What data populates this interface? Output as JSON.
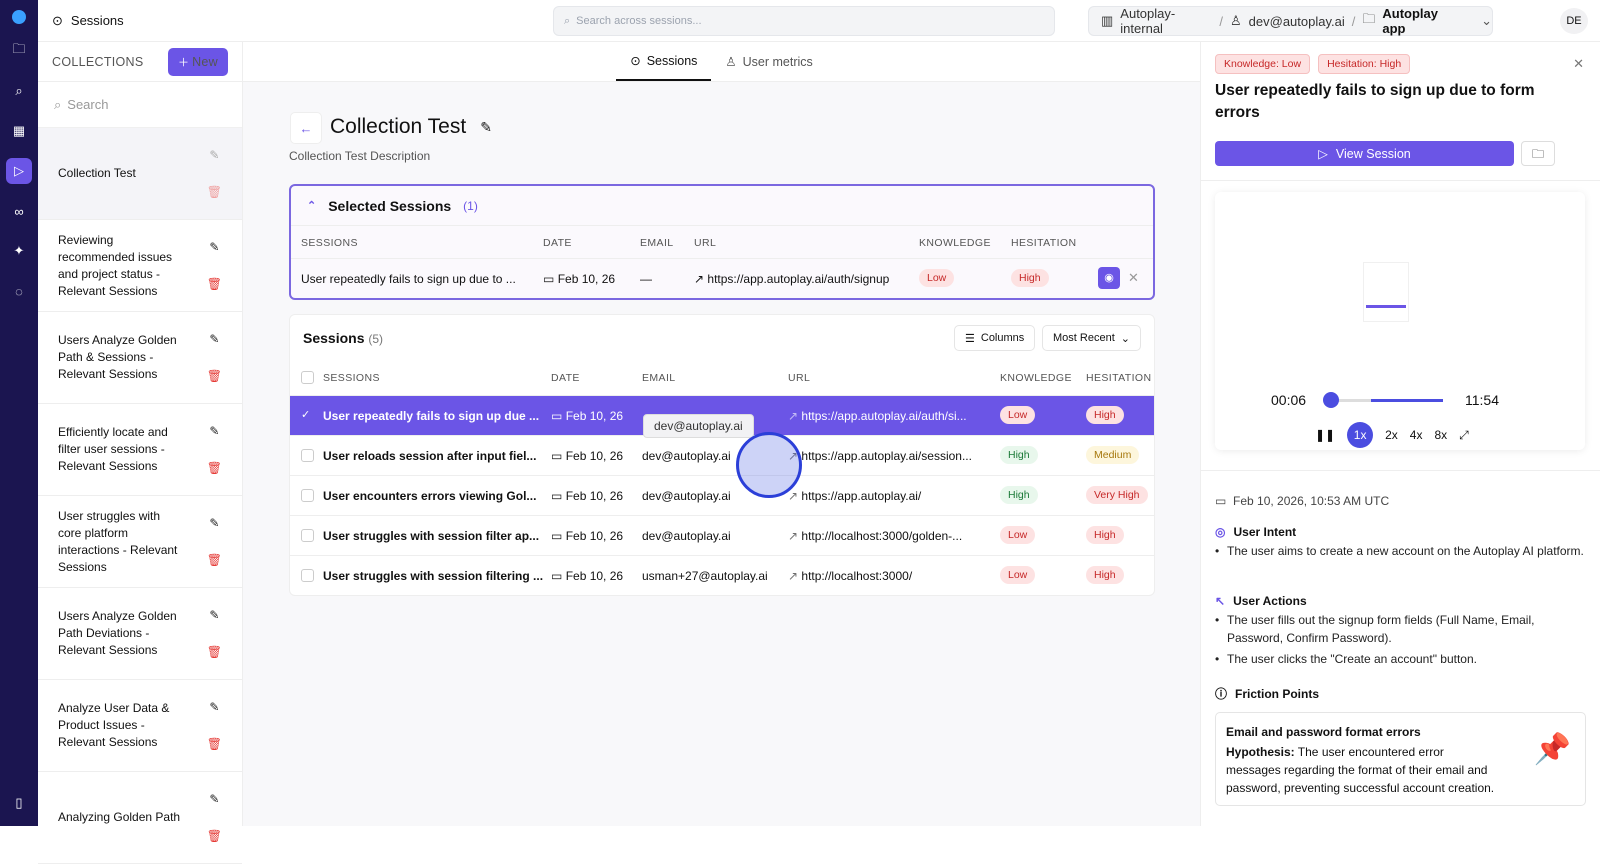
{
  "topbar": {
    "title": "Sessions",
    "search_placeholder": "Search across sessions...",
    "org": "Autoplay-internal",
    "user": "dev@autoplay.ai",
    "app": "Autoplay app",
    "avatar": "DE",
    "sep": "/"
  },
  "collections": {
    "header": "COLLECTIONS",
    "new_label": "New",
    "search_placeholder": "Search",
    "items": [
      "Collection Test",
      "Reviewing recommended issues and project status - Relevant Sessions",
      "Users Analyze Golden Path & Sessions - Relevant Sessions",
      "Efficiently locate and filter user sessions - Relevant Sessions",
      "User struggles with core platform interactions - Relevant Sessions",
      "Users Analyze Golden Path Deviations - Relevant Sessions",
      "Analyze User Data & Product Issues - Relevant Sessions",
      "Analyzing Golden Path"
    ]
  },
  "tabs": [
    "Sessions",
    "User metrics"
  ],
  "page": {
    "title": "Collection Test",
    "description": "Collection Test Description"
  },
  "columns": {
    "sessions": "SESSIONS",
    "date": "DATE",
    "email": "EMAIL",
    "url": "URL",
    "knowledge": "KNOWLEDGE",
    "hesitation": "HESITATION"
  },
  "selected": {
    "title": "Selected Sessions",
    "count": "(1)",
    "row": {
      "name": "User repeatedly fails to sign up due to ...",
      "date": "Feb 10, 26",
      "email": "—",
      "url": "https://app.autoplay.ai/auth/signup",
      "knowledge": "Low",
      "hesitation": "High"
    }
  },
  "sessions": {
    "title": "Sessions",
    "count": "(5)",
    "columns_btn": "Columns",
    "sort": "Most Recent",
    "rows": [
      {
        "name": "User repeatedly fails to sign up due ...",
        "date": "Feb 10, 26",
        "email": "",
        "url": "https://app.autoplay.ai/auth/si...",
        "knowledge": "Low",
        "hesitation": "High"
      },
      {
        "name": "User reloads session after input fiel...",
        "date": "Feb 10, 26",
        "email": "dev@autoplay.ai",
        "url": "https://app.autoplay.ai/session...",
        "knowledge": "High",
        "hesitation": "Medium"
      },
      {
        "name": "User encounters errors viewing Gol...",
        "date": "Feb 10, 26",
        "email": "dev@autoplay.ai",
        "url": "https://app.autoplay.ai/",
        "knowledge": "High",
        "hesitation": "Very High"
      },
      {
        "name": "User struggles with session filter ap...",
        "date": "Feb 10, 26",
        "email": "dev@autoplay.ai",
        "url": "http://localhost:3000/golden-...",
        "knowledge": "Low",
        "hesitation": "High"
      },
      {
        "name": "User struggles with session filtering ...",
        "date": "Feb 10, 26",
        "email": "usman+27@autoplay.ai",
        "url": "http://localhost:3000/",
        "knowledge": "Low",
        "hesitation": "High"
      }
    ],
    "tooltip": "dev@autoplay.ai"
  },
  "detail": {
    "badges": [
      "Knowledge: Low",
      "Hesitation: High"
    ],
    "title": "User repeatedly fails to sign up due to form errors",
    "view_label": "View Session",
    "player": {
      "current": "00:06",
      "total": "11:54",
      "progress": 0.01,
      "speeds": [
        "1x",
        "2x",
        "4x",
        "8x"
      ],
      "active_speed": "1x"
    },
    "datetime": "Feb 10, 2026, 10:53 AM UTC",
    "intent_title": "User Intent",
    "intent": [
      "The user aims to create a new account on the Autoplay AI platform."
    ],
    "actions_title": "User Actions",
    "actions": [
      "The user fills out the signup form fields (Full Name, Email, Password, Confirm Password).",
      "The user clicks the \"Create an account\" button."
    ],
    "friction_title": "Friction Points",
    "friction": {
      "title": "Email and password format errors",
      "hyp_label": "Hypothesis:",
      "hyp": " The user encountered error messages regarding the format of their email and password, preventing successful account creation."
    }
  },
  "colors": {
    "accent": "#6b55e6",
    "rail": "#1b1550"
  }
}
